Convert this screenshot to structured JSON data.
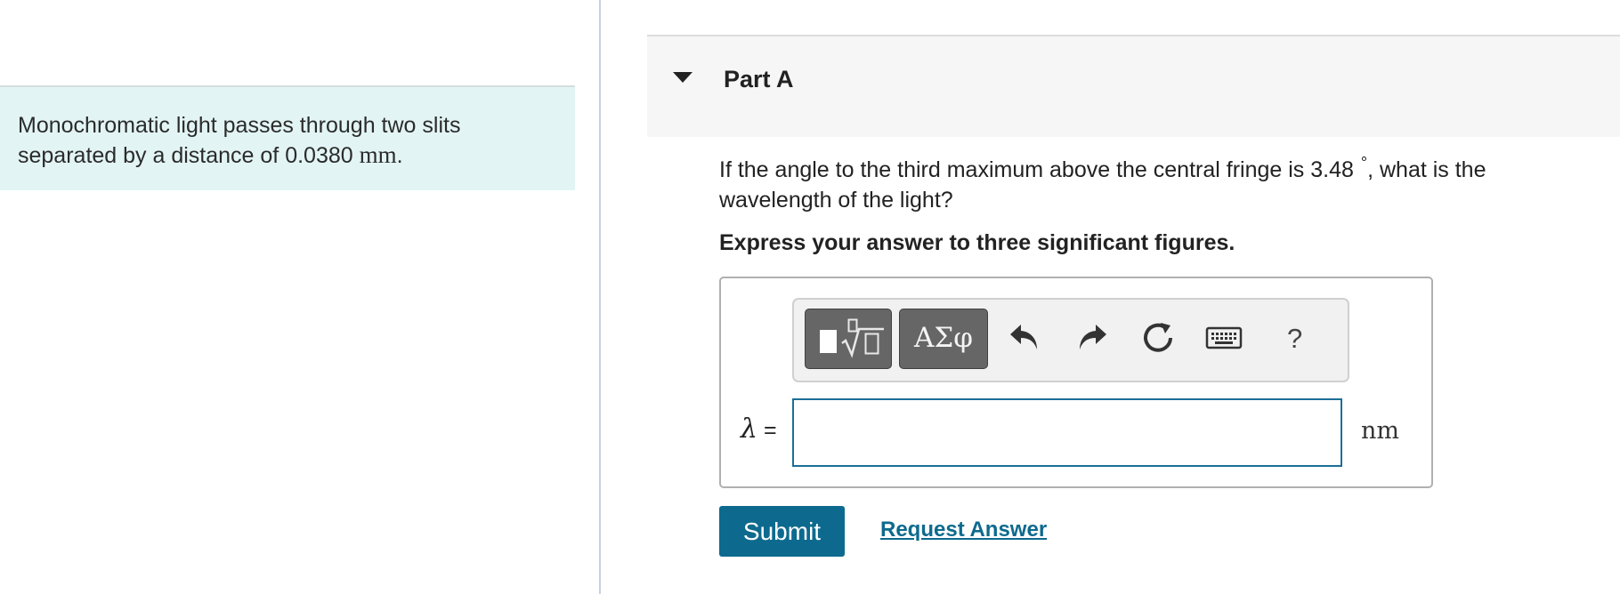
{
  "intro": {
    "text": "Monochromatic light passes through two slits separated by a distance of 0.0380",
    "unit": "mm",
    "end": "."
  },
  "part": {
    "title": "Part A",
    "question_before": "If the angle to the third maximum above the central fringe is 3.48",
    "degree_symbol": "°",
    "question_after": ", what is the wavelength of the light?",
    "instruction": "Express your answer to three significant figures."
  },
  "toolbar": {
    "templates_icon": "templates-icon",
    "greek_label": "ΑΣφ",
    "undo_icon": "undo-icon",
    "redo_icon": "redo-icon",
    "reset_icon": "reset-icon",
    "keyboard_icon": "keyboard-icon",
    "help_label": "?"
  },
  "answer": {
    "variable": "λ",
    "equals": "=",
    "value": "",
    "unit": "nm"
  },
  "actions": {
    "submit_label": "Submit",
    "request_label": "Request Answer"
  },
  "colors": {
    "intro_bg": "#e2f5f4",
    "accent": "#0d6a8e",
    "input_border": "#1b6f97",
    "toolbar_button": "#666666"
  }
}
